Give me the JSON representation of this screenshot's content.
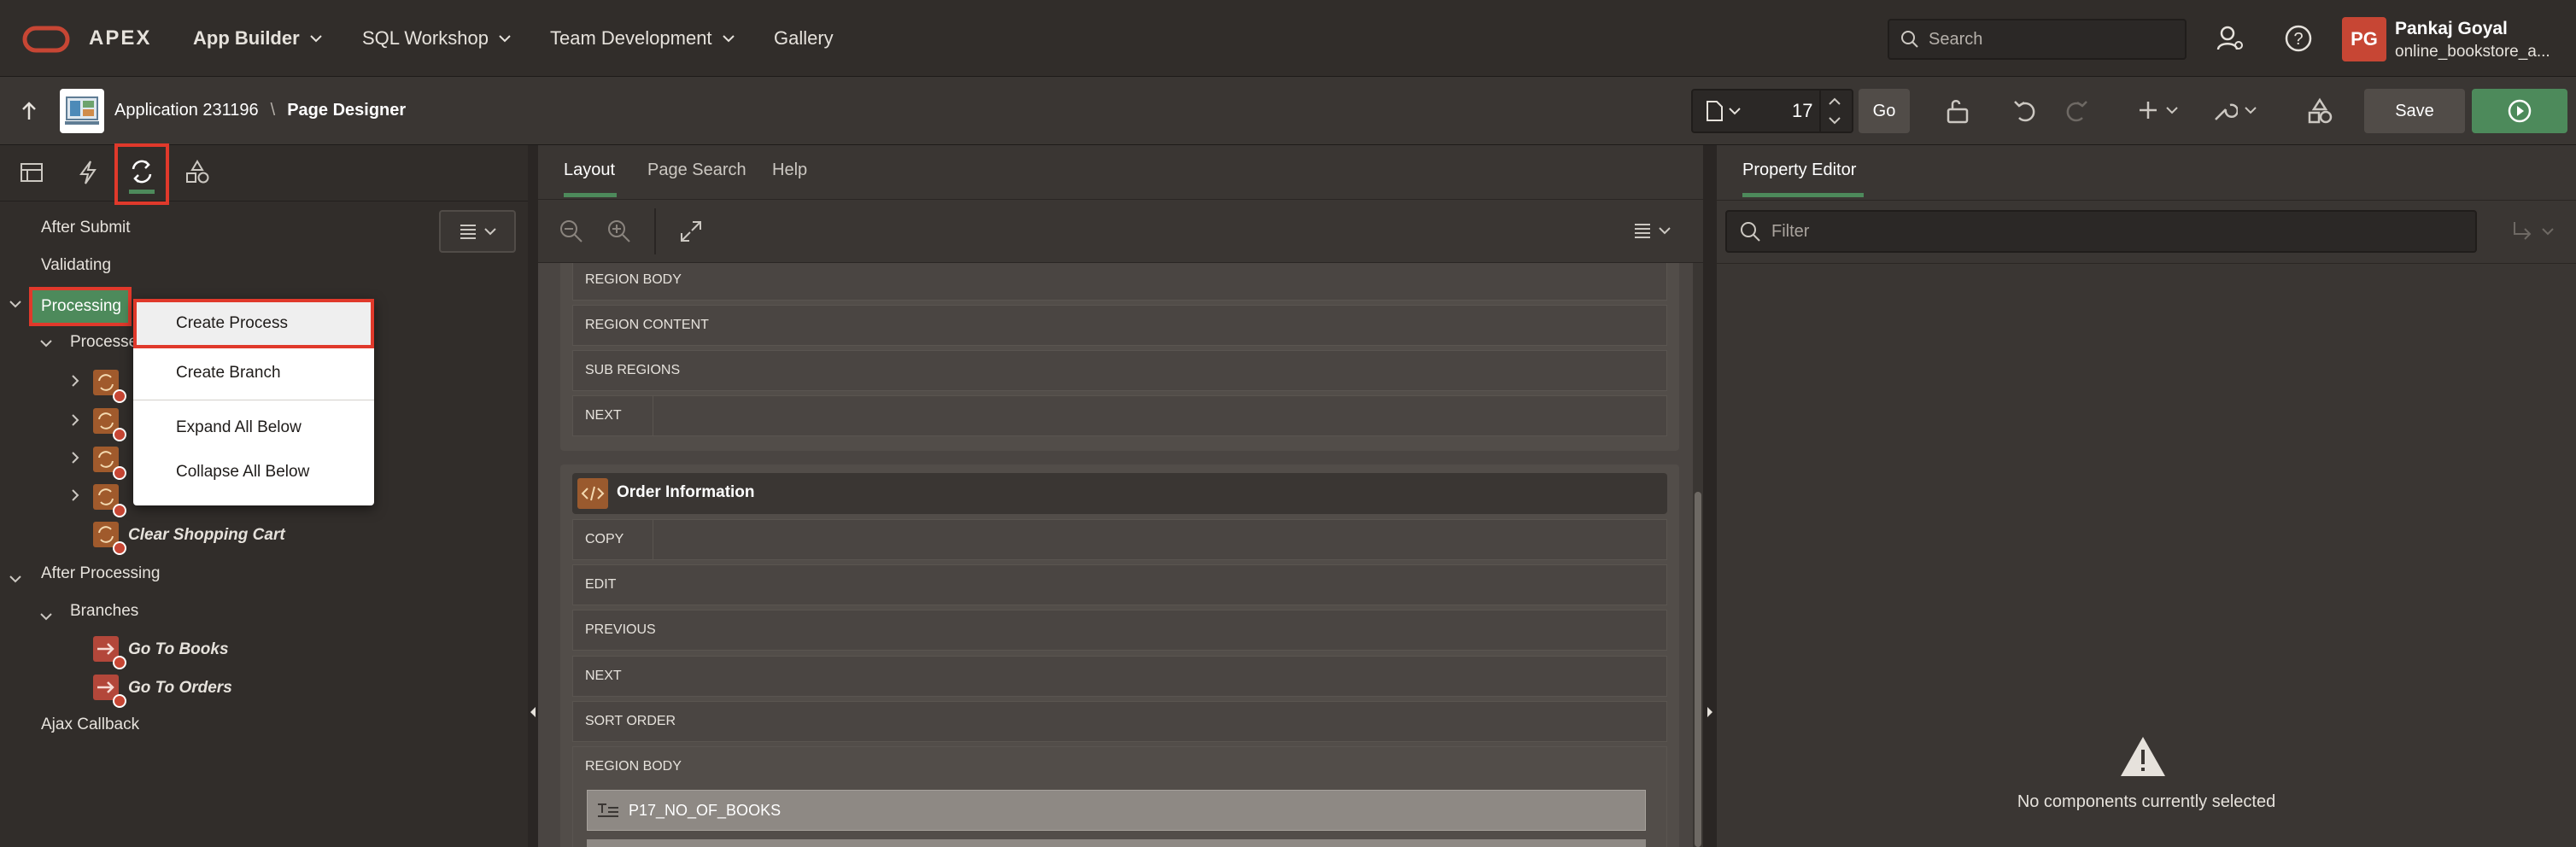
{
  "top_nav": {
    "brand": "APEX",
    "menus": [
      {
        "label": "App Builder"
      },
      {
        "label": "SQL Workshop"
      },
      {
        "label": "Team Development"
      },
      {
        "label": "Gallery"
      }
    ],
    "search_placeholder": "Search",
    "user": {
      "initials": "PG",
      "name": "Pankaj Goyal",
      "workspace": "online_bookstore_a..."
    }
  },
  "toolbar": {
    "application": "Application 231196",
    "separator": "\\",
    "page_designer": "Page Designer",
    "page_number": "17",
    "go_label": "Go",
    "save_label": "Save"
  },
  "left_pane": {
    "tree": {
      "after_submit": "After Submit",
      "validating": "Validating",
      "processing": "Processing",
      "processes": "Processes",
      "clear_cart": "Clear Shopping Cart",
      "after_processing": "After Processing",
      "branches": "Branches",
      "go_books": "Go To Books",
      "go_orders": "Go To Orders",
      "ajax_callback": "Ajax Callback"
    }
  },
  "context_menu": {
    "create_process": "Create Process",
    "create_branch": "Create Branch",
    "expand_all": "Expand All Below",
    "collapse_all": "Collapse All Below"
  },
  "middle_pane": {
    "tabs": [
      "Layout",
      "Page Search",
      "Help"
    ],
    "region_top_rows": [
      "REGION BODY",
      "REGION CONTENT",
      "SUB REGIONS",
      "NEXT"
    ],
    "order_region_title": "Order Information",
    "order_rows": [
      "COPY",
      "EDIT",
      "PREVIOUS",
      "NEXT",
      "SORT ORDER",
      "REGION BODY"
    ],
    "item": "P17_NO_OF_BOOKS"
  },
  "right_pane": {
    "tab": "Property Editor",
    "filter_placeholder": "Filter",
    "empty_message": "No components currently selected"
  },
  "colors": {
    "accent_green": "#4d8a5b",
    "brand_red": "#c74634",
    "highlight_red": "#e0392b"
  }
}
